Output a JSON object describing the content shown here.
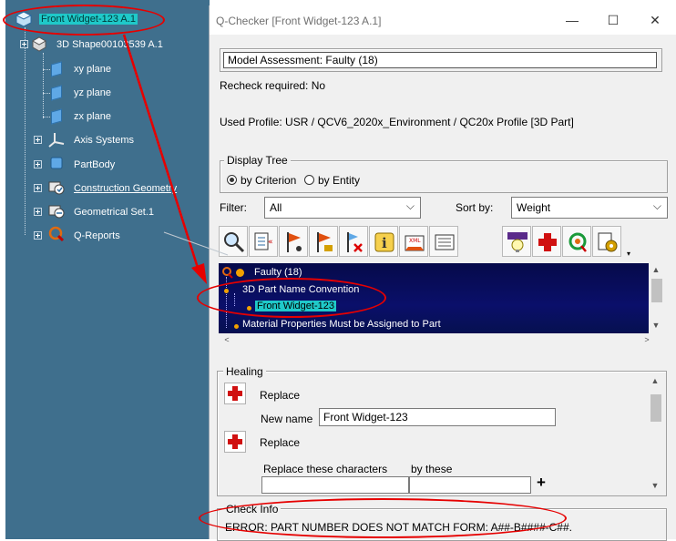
{
  "tree": {
    "root": "Front Widget-123 A.1",
    "items": [
      {
        "label": "3D Shape00103539 A.1",
        "icon": "3d-shape-icon"
      },
      {
        "label": "xy plane",
        "icon": "plane-icon"
      },
      {
        "label": "yz plane",
        "icon": "plane-icon"
      },
      {
        "label": "zx plane",
        "icon": "plane-icon"
      },
      {
        "label": "Axis Systems",
        "icon": "axis-system-icon"
      },
      {
        "label": "PartBody",
        "icon": "part-body-icon"
      },
      {
        "label": "Construction Geometry",
        "icon": "construction-geometry-icon"
      },
      {
        "label": "Geometrical Set.1",
        "icon": "geometrical-set-icon"
      },
      {
        "label": "Q-Reports",
        "icon": "q-reports-icon"
      }
    ]
  },
  "dialog": {
    "title": "Q-Checker [Front Widget-123 A.1]",
    "minimize": "—",
    "maximize": "☐",
    "close": "✕",
    "assessment": "Model Assessment: Faulty (18)",
    "recheck": "Recheck required: No",
    "profile": "Used Profile: USR / QCV6_2020x_Environment / QC20x Profile [3D Part]",
    "display_tree": {
      "legend": "Display Tree",
      "by_criterion": "by Criterion",
      "by_entity": "by Entity",
      "selected": "by Criterion"
    },
    "filter": {
      "label": "Filter:",
      "value": "All"
    },
    "sort": {
      "label": "Sort by:",
      "value": "Weight"
    },
    "toolbar": [
      "analyze-icon",
      "list-icon",
      "flag-view-icon",
      "flag-lock-icon",
      "flag-delete-icon",
      "info-icon",
      "xml-icon",
      "report-list-icon",
      "hint-icon",
      "heal-icon",
      "refresh-icon",
      "settings-icon"
    ],
    "results": [
      {
        "label": "Faulty (18)",
        "level": 0
      },
      {
        "label": "3D Part Name Convention",
        "level": 1
      },
      {
        "label": "Front Widget-123",
        "level": 2
      },
      {
        "label": "Material Properties Must be Assigned to Part",
        "level": 1
      }
    ],
    "healing": {
      "legend": "Healing",
      "replace1": "Replace",
      "new_name_label": "New name",
      "new_name_value": "Front Widget-123",
      "replace2": "Replace",
      "replace_chars_label": "Replace these characters",
      "by_these_label": "by these",
      "replace_chars_value": "",
      "by_these_value": "",
      "add": "+"
    },
    "check_info": {
      "legend": "Check Info",
      "text": "ERROR: PART NUMBER DOES NOT MATCH FORM: A##-B####-C##."
    }
  },
  "colors": {
    "tree_bg": "#3f6f8d",
    "results_bg": "#0a0f6a",
    "highlight": "#1fc9c9",
    "annotation": "#e60000"
  }
}
